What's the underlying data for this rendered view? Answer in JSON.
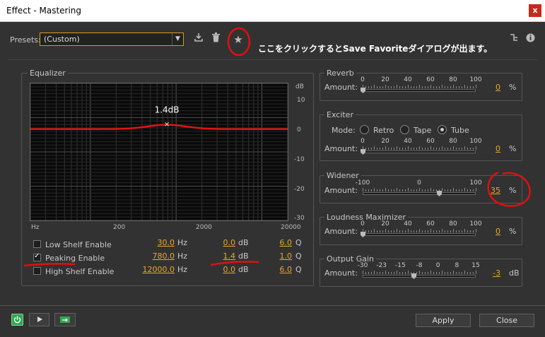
{
  "window": {
    "title": "Effect - Mastering",
    "close": "x"
  },
  "toolbar": {
    "presets_label": "Presets:",
    "preset_value": "(Custom)",
    "annotation": "ここをクリックするとSave Favoriteダイアログが出ます。"
  },
  "equalizer": {
    "title": "Equalizer",
    "db_unit": "dB",
    "y_ticks": [
      "10",
      "0",
      "-10",
      "-20",
      "-30"
    ],
    "x_ticks": [
      "Hz",
      "200",
      "2000",
      "20000"
    ],
    "peak_label": "1.4dB",
    "rows": [
      {
        "label": "Low Shelf Enable",
        "checked": false,
        "freq": "30.0",
        "freq_unit": "Hz",
        "gain": "0.0",
        "gain_unit": "dB",
        "q": "6.0",
        "q_unit": "Q"
      },
      {
        "label": "Peaking Enable",
        "checked": true,
        "freq": "780.0",
        "freq_unit": "Hz",
        "gain": "1.4",
        "gain_unit": "dB",
        "q": "1.0",
        "q_unit": "Q"
      },
      {
        "label": "High Shelf Enable",
        "checked": false,
        "freq": "12000.0",
        "freq_unit": "Hz",
        "gain": "0.0",
        "gain_unit": "dB",
        "q": "6.0",
        "q_unit": "Q"
      }
    ]
  },
  "reverb": {
    "title": "Reverb",
    "amount_label": "Amount:",
    "ticks": [
      "0",
      "20",
      "40",
      "60",
      "80",
      "100"
    ],
    "value": "0",
    "unit": "%",
    "level": 0
  },
  "exciter": {
    "title": "Exciter",
    "mode_label": "Mode:",
    "modes": [
      "Retro",
      "Tape",
      "Tube"
    ],
    "selected_mode": "Tube",
    "amount_label": "Amount:",
    "ticks": [
      "0",
      "20",
      "40",
      "60",
      "80",
      "100"
    ],
    "value": "0",
    "unit": "%",
    "level": 0
  },
  "widener": {
    "title": "Widener",
    "amount_label": "Amount:",
    "ticks": [
      "-100",
      "0",
      "100"
    ],
    "value": "35",
    "unit": "%",
    "level": 0.675
  },
  "loudness": {
    "title": "Loudness Maximizer",
    "amount_label": "Amount:",
    "ticks": [
      "0",
      "20",
      "40",
      "60",
      "80",
      "100"
    ],
    "value": "0",
    "unit": "%",
    "level": 0
  },
  "output_gain": {
    "title": "Output Gain",
    "amount_label": "Amount:",
    "ticks": [
      "-30",
      "-23",
      "-15",
      "-8",
      "0",
      "8",
      "15"
    ],
    "value": "-3",
    "unit": "dB",
    "level": 0.45
  },
  "footer": {
    "apply": "Apply",
    "close": "Close"
  },
  "colors": {
    "accent": "#e8a72a",
    "annotation_red": "#e01010",
    "power_green": "#2fa84f"
  }
}
